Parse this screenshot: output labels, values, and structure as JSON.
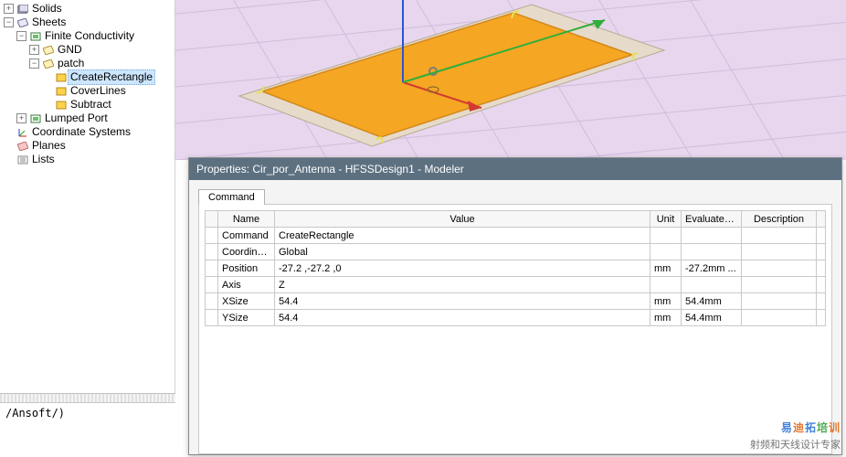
{
  "tree": {
    "solids": "Solids",
    "sheets": "Sheets",
    "finite": "Finite Conductivity",
    "gnd": "GND",
    "patch": "patch",
    "create_rect": "CreateRectangle",
    "cover_lines": "CoverLines",
    "subtract": "Subtract",
    "lumped": "Lumped Port",
    "coord": "Coordinate Systems",
    "planes": "Planes",
    "lists": "Lists"
  },
  "path_bar": "/Ansoft/)",
  "props": {
    "title": "Properties: Cir_por_Antenna - HFSSDesign1 - Modeler",
    "tab": "Command",
    "headers": {
      "name": "Name",
      "value": "Value",
      "unit": "Unit",
      "eval": "Evaluated...",
      "desc": "Description"
    },
    "rows": [
      {
        "name": "Command",
        "value": "CreateRectangle",
        "unit": "",
        "eval": "",
        "desc": ""
      },
      {
        "name": "Coordina...",
        "value": "Global",
        "unit": "",
        "eval": "",
        "desc": ""
      },
      {
        "name": "Position",
        "value": "-27.2 ,-27.2 ,0",
        "unit": "mm",
        "eval": "-27.2mm ...",
        "desc": ""
      },
      {
        "name": "Axis",
        "value": "Z",
        "unit": "",
        "eval": "",
        "desc": ""
      },
      {
        "name": "XSize",
        "value": "54.4",
        "unit": "mm",
        "eval": "54.4mm",
        "desc": ""
      },
      {
        "name": "YSize",
        "value": "54.4",
        "unit": "mm",
        "eval": "54.4mm",
        "desc": ""
      }
    ]
  },
  "watermark": {
    "line1": "易迪拓培训",
    "line2": "射频和天线设计专家"
  }
}
